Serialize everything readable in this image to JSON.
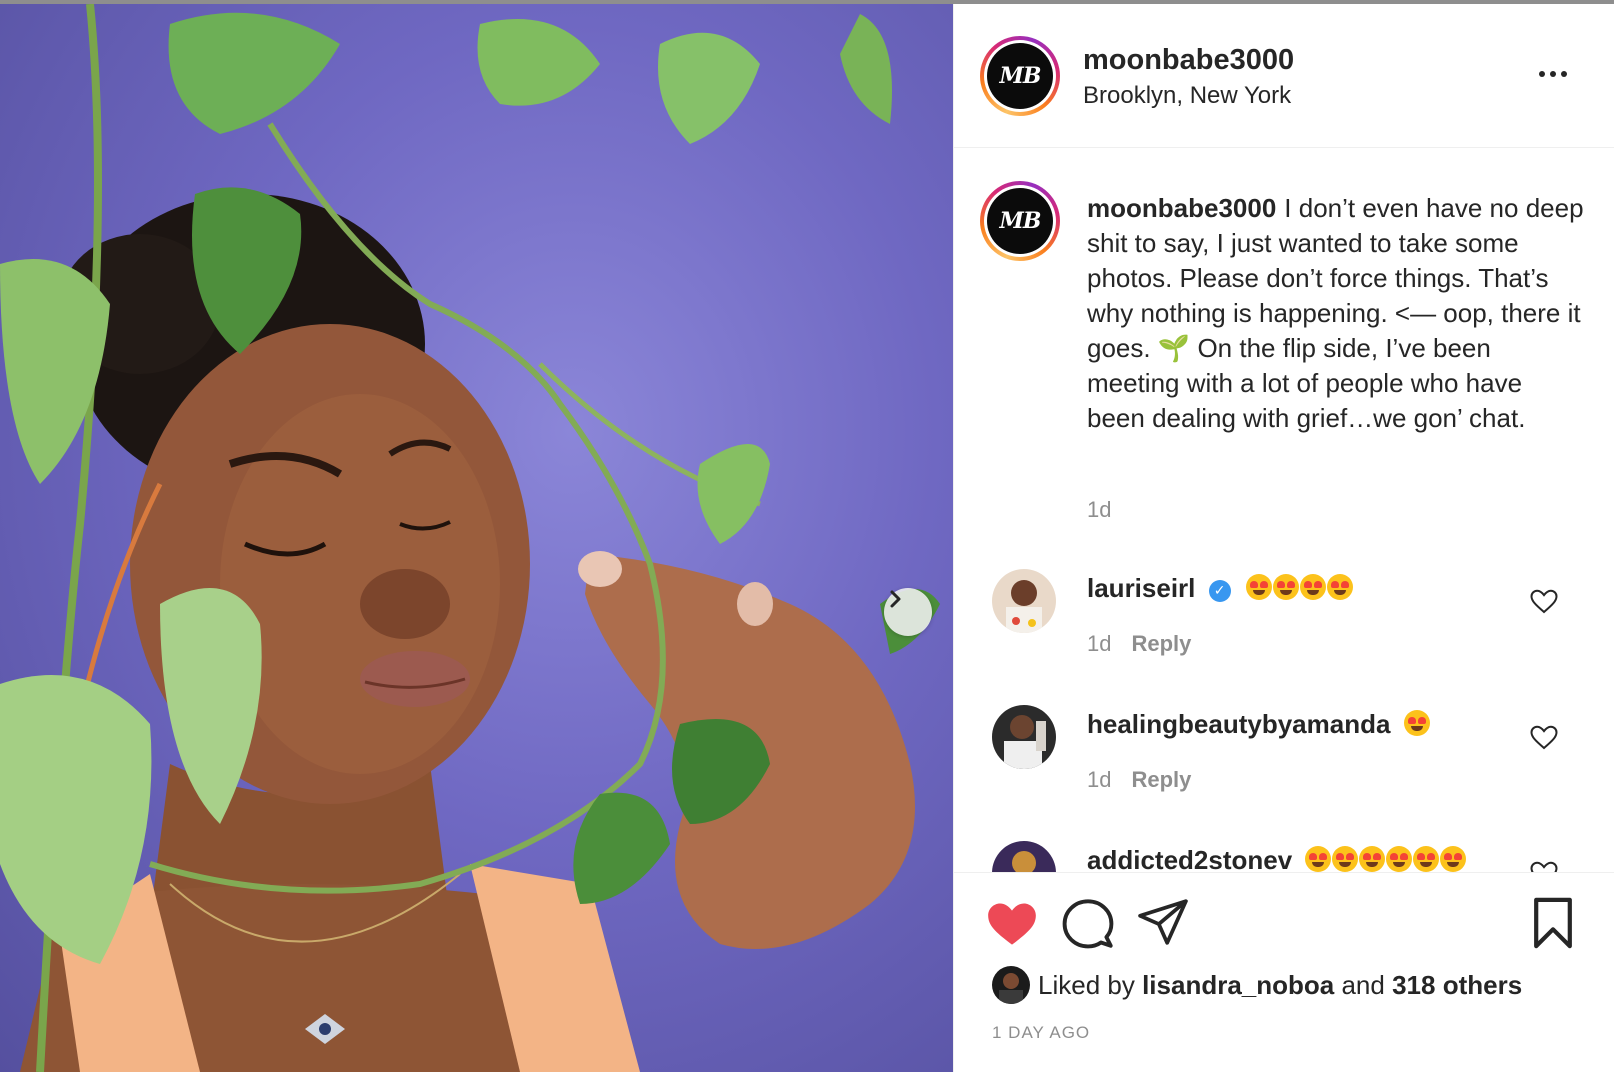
{
  "post": {
    "username": "moonbabe3000",
    "location": "Brooklyn, New York",
    "avatar_initials": "MB"
  },
  "caption": {
    "username": "moonbabe3000",
    "text_main": "I don’t even have no deep shit to say, I just wanted to take some photos. Please don’t force things. That’s why nothing is happening. <— oop, there it goes.",
    "sprout_icon": "🌱",
    "text_rest": "On the flip side, I’ve been meeting with a lot of people who have been dealing with grief…we gon’ chat.",
    "time": "1d"
  },
  "comments": [
    {
      "username": "lauriseirl",
      "verified": true,
      "emoji_count": 4,
      "time": "1d",
      "reply_label": "Reply"
    },
    {
      "username": "healingbeautybyamanda",
      "verified": false,
      "emoji_count": 1,
      "time": "1d",
      "reply_label": "Reply"
    },
    {
      "username": "addicted2stonev",
      "verified": false,
      "emoji_count": 6,
      "time": "",
      "reply_label": ""
    }
  ],
  "likes": {
    "prefix": "Liked by",
    "liker": "lisandra_noboa",
    "and": "and",
    "others": "318 others"
  },
  "timestamp": "1 DAY AGO",
  "icons": {
    "more": "more-options-icon",
    "next": "chevron-right-icon",
    "like": "heart-filled-icon",
    "comment": "comment-bubble-icon",
    "share": "paper-plane-icon",
    "save": "bookmark-icon",
    "comment_like": "heart-outline-icon",
    "verified": "verified-badge-icon",
    "emoji": "heart-eyes-emoji"
  },
  "colors": {
    "like_red": "#ed4956",
    "verified_blue": "#3897f0",
    "muted_text": "#8e8e8e",
    "background_purple": "#6f68c2"
  }
}
